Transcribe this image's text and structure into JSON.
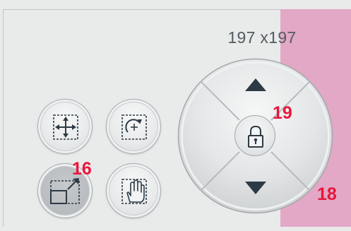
{
  "dimension": {
    "label": "197 x197"
  },
  "buttons": [
    {
      "name": "move-button",
      "icon": "move-arrows-icon",
      "active": false
    },
    {
      "name": "rotate-button",
      "icon": "rotate-icon",
      "active": false
    },
    {
      "name": "resize-button",
      "icon": "resize-icon",
      "active": true
    },
    {
      "name": "pan-button",
      "icon": "hand-icon",
      "active": false
    }
  ],
  "dpad": {
    "up_icon": "triangle-up-icon",
    "down_icon": "triangle-down-icon",
    "center_icon": "lock-icon"
  },
  "callouts": {
    "resize": "16",
    "lock": "19",
    "dpad": "18"
  },
  "colors": {
    "accent_pink": "#e2a8c5",
    "callout_red": "#e8173c",
    "icon_dark": "#2d3a44"
  }
}
